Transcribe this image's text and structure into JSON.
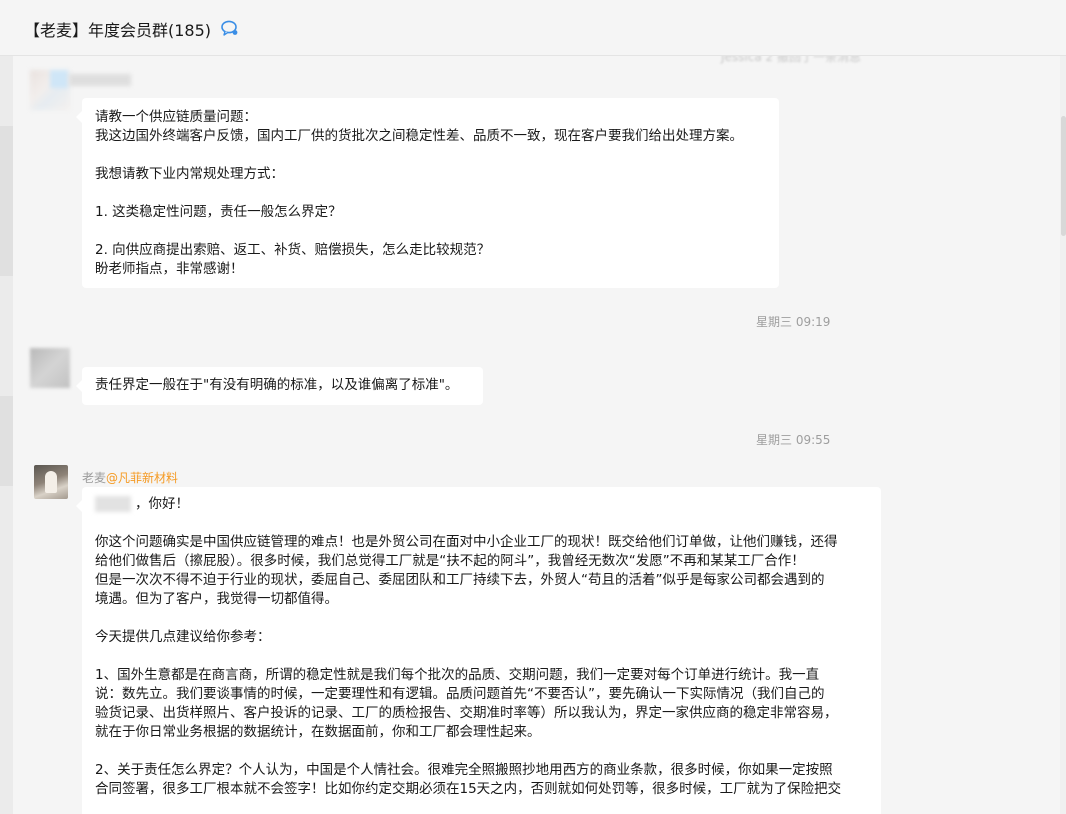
{
  "header": {
    "title": "【老麦】年度会员群(185)",
    "chat_icon": "chat-bubble-icon"
  },
  "messages": [
    {
      "lines": [
        "请教一个供应链质量问题：",
        "我这边国外终端客户反馈，国内工厂供的货批次之间稳定性差、品质不一致，现在客户要我们给出处理方案。",
        "",
        "我想请教下业内常规处理方式：",
        "",
        "1. 这类稳定性问题，责任一般怎么界定？",
        "",
        "2. 向供应商提出索赔、返工、补货、赔偿损失，怎么走比较规范？",
        "盼老师指点，非常感谢！"
      ]
    },
    {
      "lines": [
        "责任界定一般在于\"有没有明确的标准，以及谁偏离了标准\"。"
      ]
    },
    {
      "sender_name": "老麦",
      "sender_company": "@凡菲新材料",
      "greeting": "，你好！",
      "lines": [
        "",
        "你这个问题确实是中国供应链管理的难点！也是外贸公司在面对中小企业工厂的现状！既交给他们订单做，让他们赚钱，还得",
        "给他们做售后（擦屁股）。很多时候，我们总觉得工厂就是“扶不起的阿斗”，我曾经无数次“发愿”不再和某某工厂合作！",
        "但是一次次不得不迫于行业的现状，委屈自己、委屈团队和工厂持续下去，外贸人“苟且的活着”似乎是每家公司都会遇到的",
        "境遇。但为了客户，我觉得一切都值得。",
        "",
        "今天提供几点建议给你参考：",
        "",
        "1、国外生意都是在商言商，所谓的稳定性就是我们每个批次的品质、交期问题，我们一定要对每个订单进行统计。我一直",
        "说：数先立。我们要谈事情的时候，一定要理性和有逻辑。品质问题首先“不要否认”，要先确认一下实际情况（我们自己的",
        "验货记录、出货样照片、客户投诉的记录、工厂的质检报告、交期准时率等）所以我认为，界定一家供应商的稳定非常容易，",
        "就在于你日常业务根据的数据统计，在数据面前，你和工厂都会理性起来。",
        "",
        "2、关于责任怎么界定？个人认为，中国是个人情社会。很难完全照搬照抄地用西方的商业条款，很多时候，你如果一定按照",
        "合同签署，很多工厂根本就不会签字！比如你约定交期必须在15天之内，否则就如何处罚等，很多时候，工厂就为了保险把交"
      ]
    }
  ],
  "timestamps": [
    "星期三 09:19",
    "星期三 09:55"
  ]
}
